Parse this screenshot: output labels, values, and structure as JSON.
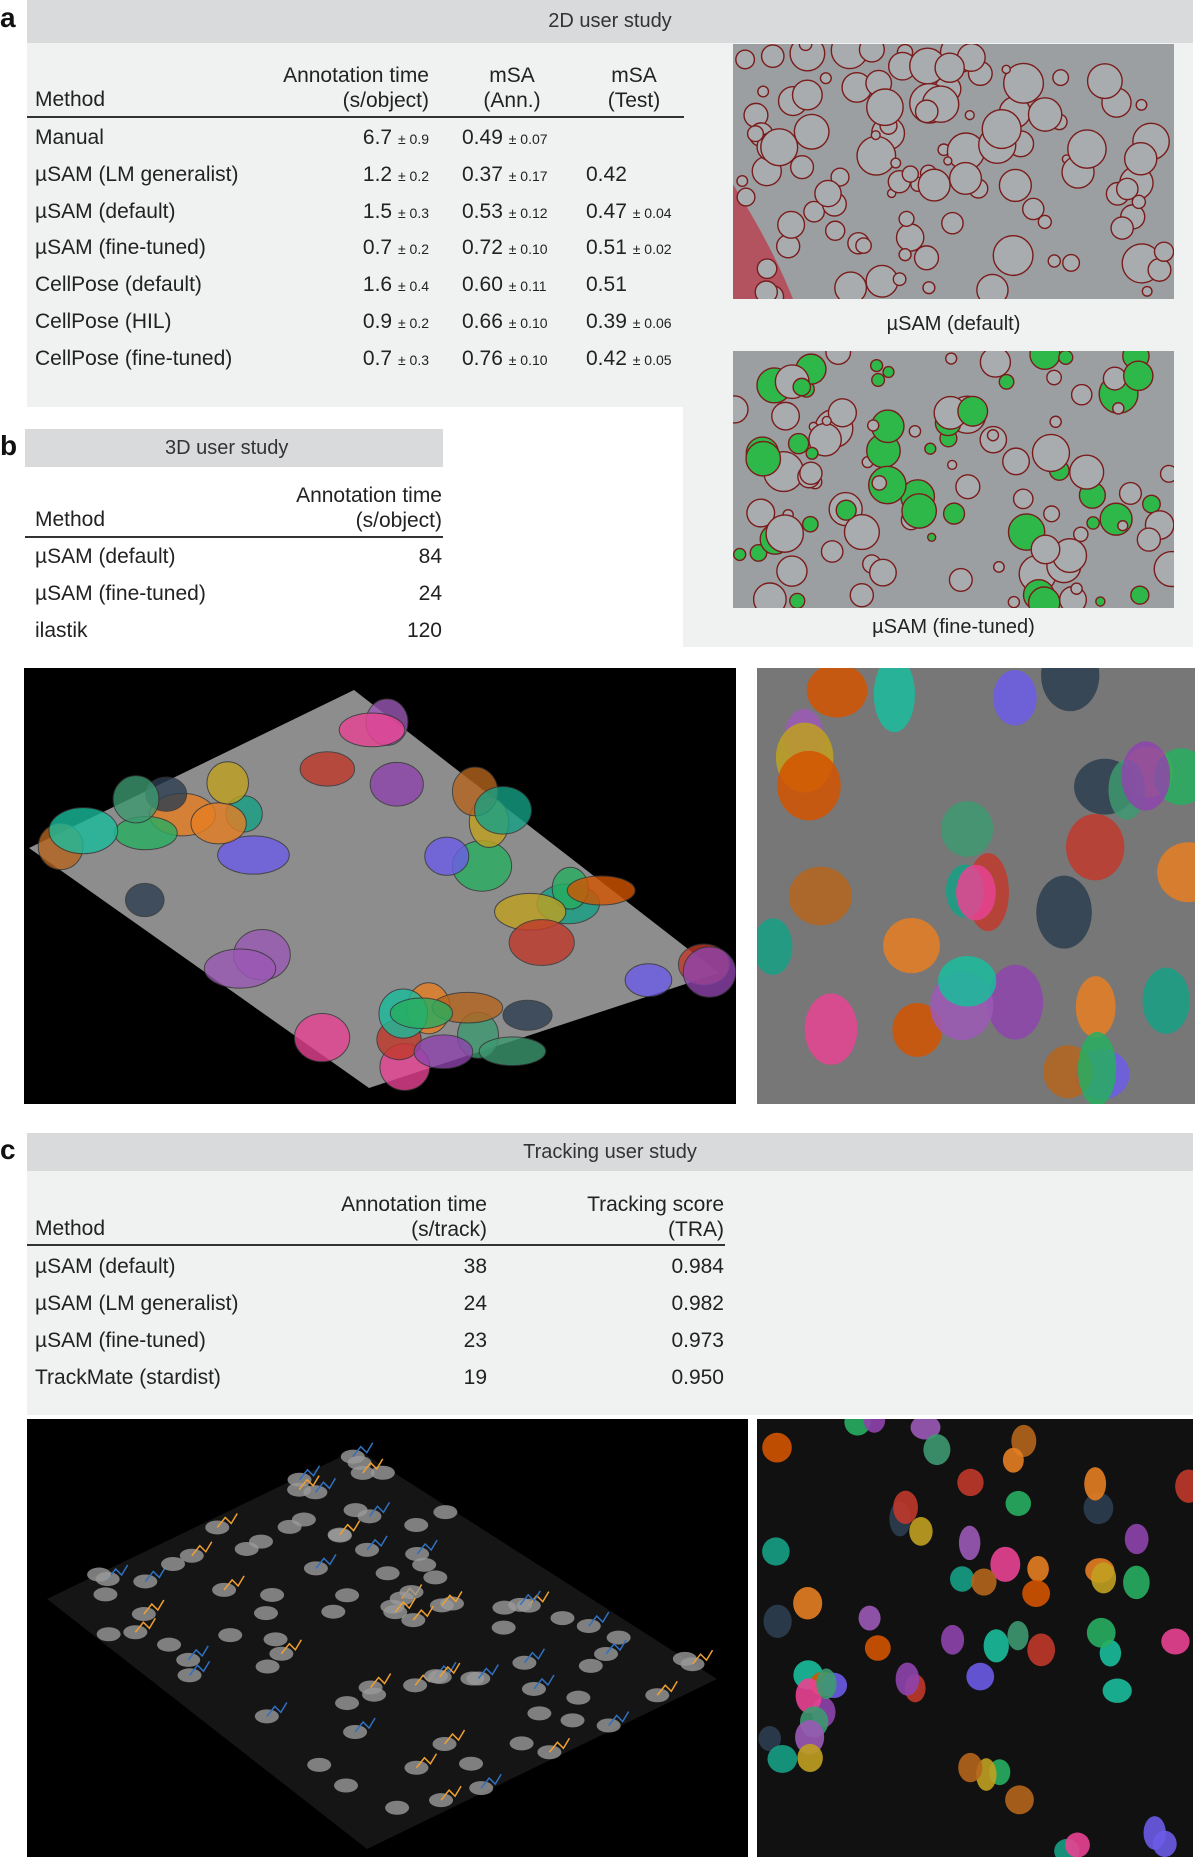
{
  "panel_a": {
    "label": "a",
    "title": "2D user study",
    "columns": [
      "Method",
      "Annotation time\n(s/object)",
      "mSA\n(Ann.)",
      "mSA\n(Test)"
    ],
    "col_time": [
      "Annotation time",
      "(s/object)"
    ],
    "col_ann": [
      "mSA",
      "(Ann.)"
    ],
    "col_test": [
      "mSA",
      "(Test)"
    ],
    "rows": [
      {
        "method": "Manual",
        "time": "6.7",
        "time_sd": "± 0.9",
        "ann": "0.49",
        "ann_sd": "± 0.07",
        "test": "",
        "test_sd": ""
      },
      {
        "method": "µSAM (LM generalist)",
        "time": "1.2",
        "time_sd": "± 0.2",
        "ann": "0.37",
        "ann_sd": "± 0.17",
        "test": "0.42",
        "test_sd": ""
      },
      {
        "method": "µSAM (default)",
        "time": "1.5",
        "time_sd": "± 0.3",
        "ann": "0.53",
        "ann_sd": "± 0.12",
        "test": "0.47",
        "test_sd": "± 0.04"
      },
      {
        "method": "µSAM (fine-tuned)",
        "time": "0.7",
        "time_sd": "± 0.2",
        "ann": "0.72",
        "ann_sd": "± 0.10",
        "test": "0.51",
        "test_sd": "± 0.02"
      },
      {
        "method": "CellPose (default)",
        "time": "1.6",
        "time_sd": "± 0.4",
        "ann": "0.60",
        "ann_sd": "± 0.11",
        "test": "0.51",
        "test_sd": ""
      },
      {
        "method": "CellPose (HIL)",
        "time": "0.9",
        "time_sd": "± 0.2",
        "ann": "0.66",
        "ann_sd": "± 0.10",
        "test": "0.39",
        "test_sd": "± 0.06"
      },
      {
        "method": "CellPose (fine-tuned)",
        "time": "0.7",
        "time_sd": "± 0.3",
        "ann": "0.76",
        "ann_sd": "± 0.10",
        "test": "0.42",
        "test_sd": "± 0.05"
      }
    ],
    "image_captions": [
      "µSAM (default)",
      "µSAM (fine-tuned)"
    ]
  },
  "panel_b": {
    "label": "b",
    "title": "3D user study",
    "col_method": "Method",
    "col_time": [
      "Annotation time",
      "(s/object)"
    ],
    "rows": [
      {
        "method": "µSAM (default)",
        "time": "84"
      },
      {
        "method": "µSAM (fine-tuned)",
        "time": "24"
      },
      {
        "method": "ilastik",
        "time": "120"
      }
    ]
  },
  "panel_c": {
    "label": "c",
    "title": "Tracking user study",
    "col_method": "Method",
    "col_time": [
      "Annotation time",
      "(s/track)"
    ],
    "col_score": [
      "Tracking score",
      "(TRA)"
    ],
    "rows": [
      {
        "method": "µSAM (default)",
        "time": "38",
        "score": "0.984"
      },
      {
        "method": "µSAM (LM generalist)",
        "time": "24",
        "score": "0.982"
      },
      {
        "method": "µSAM (fine-tuned)",
        "time": "23",
        "score": "0.973"
      },
      {
        "method": "TrackMate (stardist)",
        "time": "19",
        "score": "0.950"
      }
    ]
  },
  "colors": {
    "header": "#d9dadc",
    "table_bg": "#f0f1f1",
    "outline_red": "#8b1a1a",
    "fill_green": "#2fb84a"
  }
}
